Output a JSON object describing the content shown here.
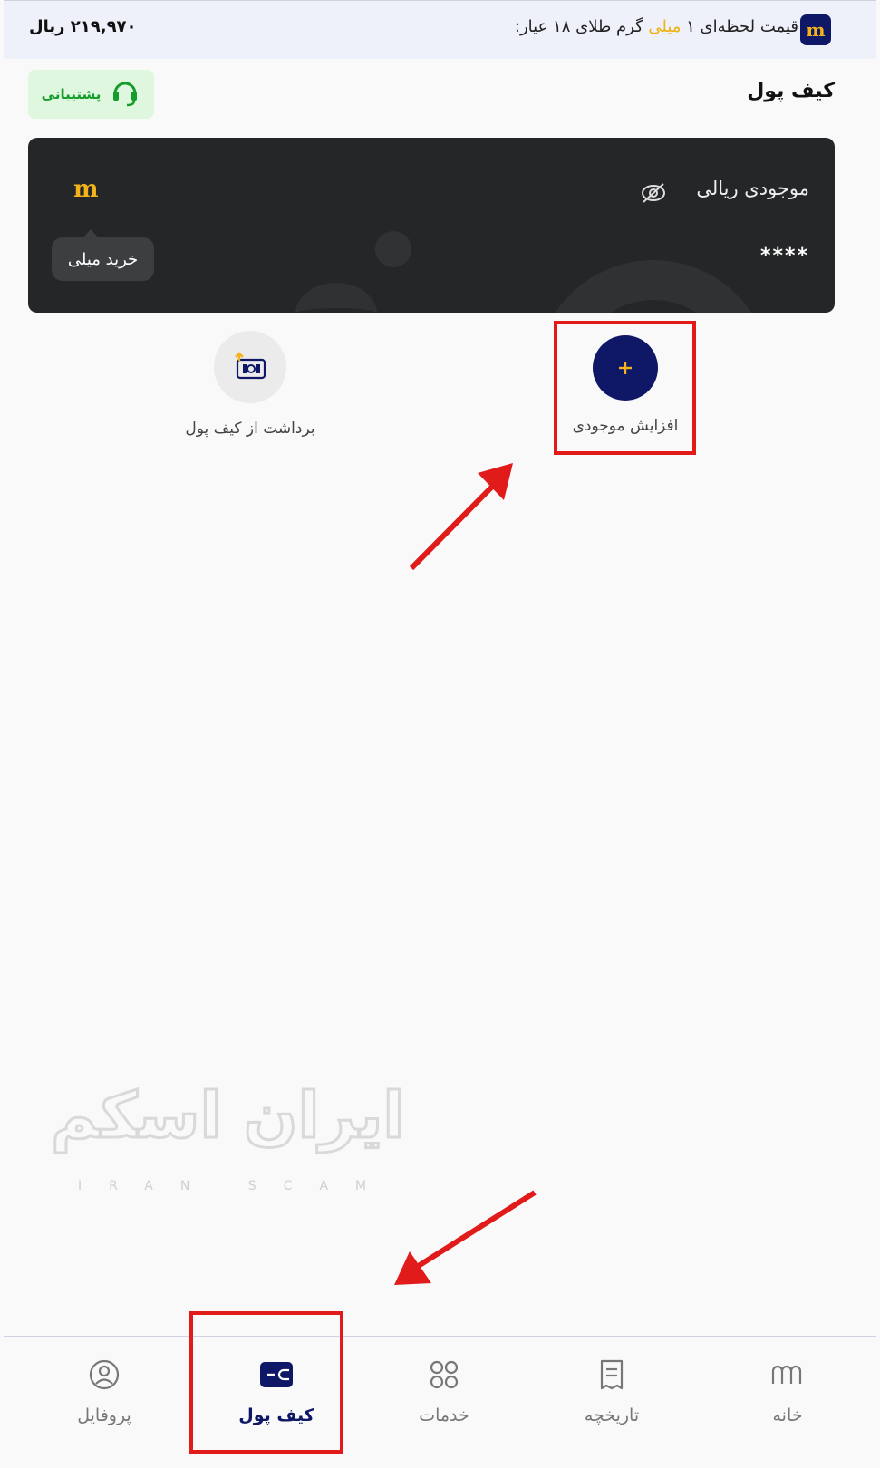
{
  "topbar": {
    "logo_icon": "milli-logo-icon",
    "price_prefix": "قیمت لحظه‌ای ۱",
    "price_brand": "میلی",
    "price_suffix": "گرم طلای ۱۸ عیار:",
    "price_value": "۲۱۹,۹۷۰ ریال"
  },
  "header": {
    "title": "کیف پول",
    "support_label": "پشتیبانی",
    "support_icon": "headset-icon"
  },
  "card": {
    "title": "موجودی ریالی",
    "hide_icon": "eye-off-icon",
    "balance": "****",
    "logo": "m",
    "buy_label": "خرید میلی"
  },
  "actions": {
    "deposit_label": "افزایش موجودی",
    "deposit_icon": "plus-icon",
    "withdraw_label": "برداشت از کیف پول",
    "withdraw_icon": "withdraw-icon"
  },
  "watermark": {
    "brand": "ایران اسکم",
    "brand_latin": "IRAN SCAM"
  },
  "nav": [
    {
      "label": "پروفایل",
      "icon": "user-icon"
    },
    {
      "label": "کیف پول",
      "icon": "wallet-icon"
    },
    {
      "label": "خدمات",
      "icon": "grid-icon"
    },
    {
      "label": "تاریخچه",
      "icon": "receipt-icon"
    },
    {
      "label": "خانه",
      "icon": "home-logo-icon"
    }
  ],
  "colors": {
    "brand_navy": "#0f1767",
    "brand_gold": "#f3b21b",
    "card_bg": "#252628",
    "support_green": "#169c2a",
    "annotation_red": "#e11a1a"
  }
}
